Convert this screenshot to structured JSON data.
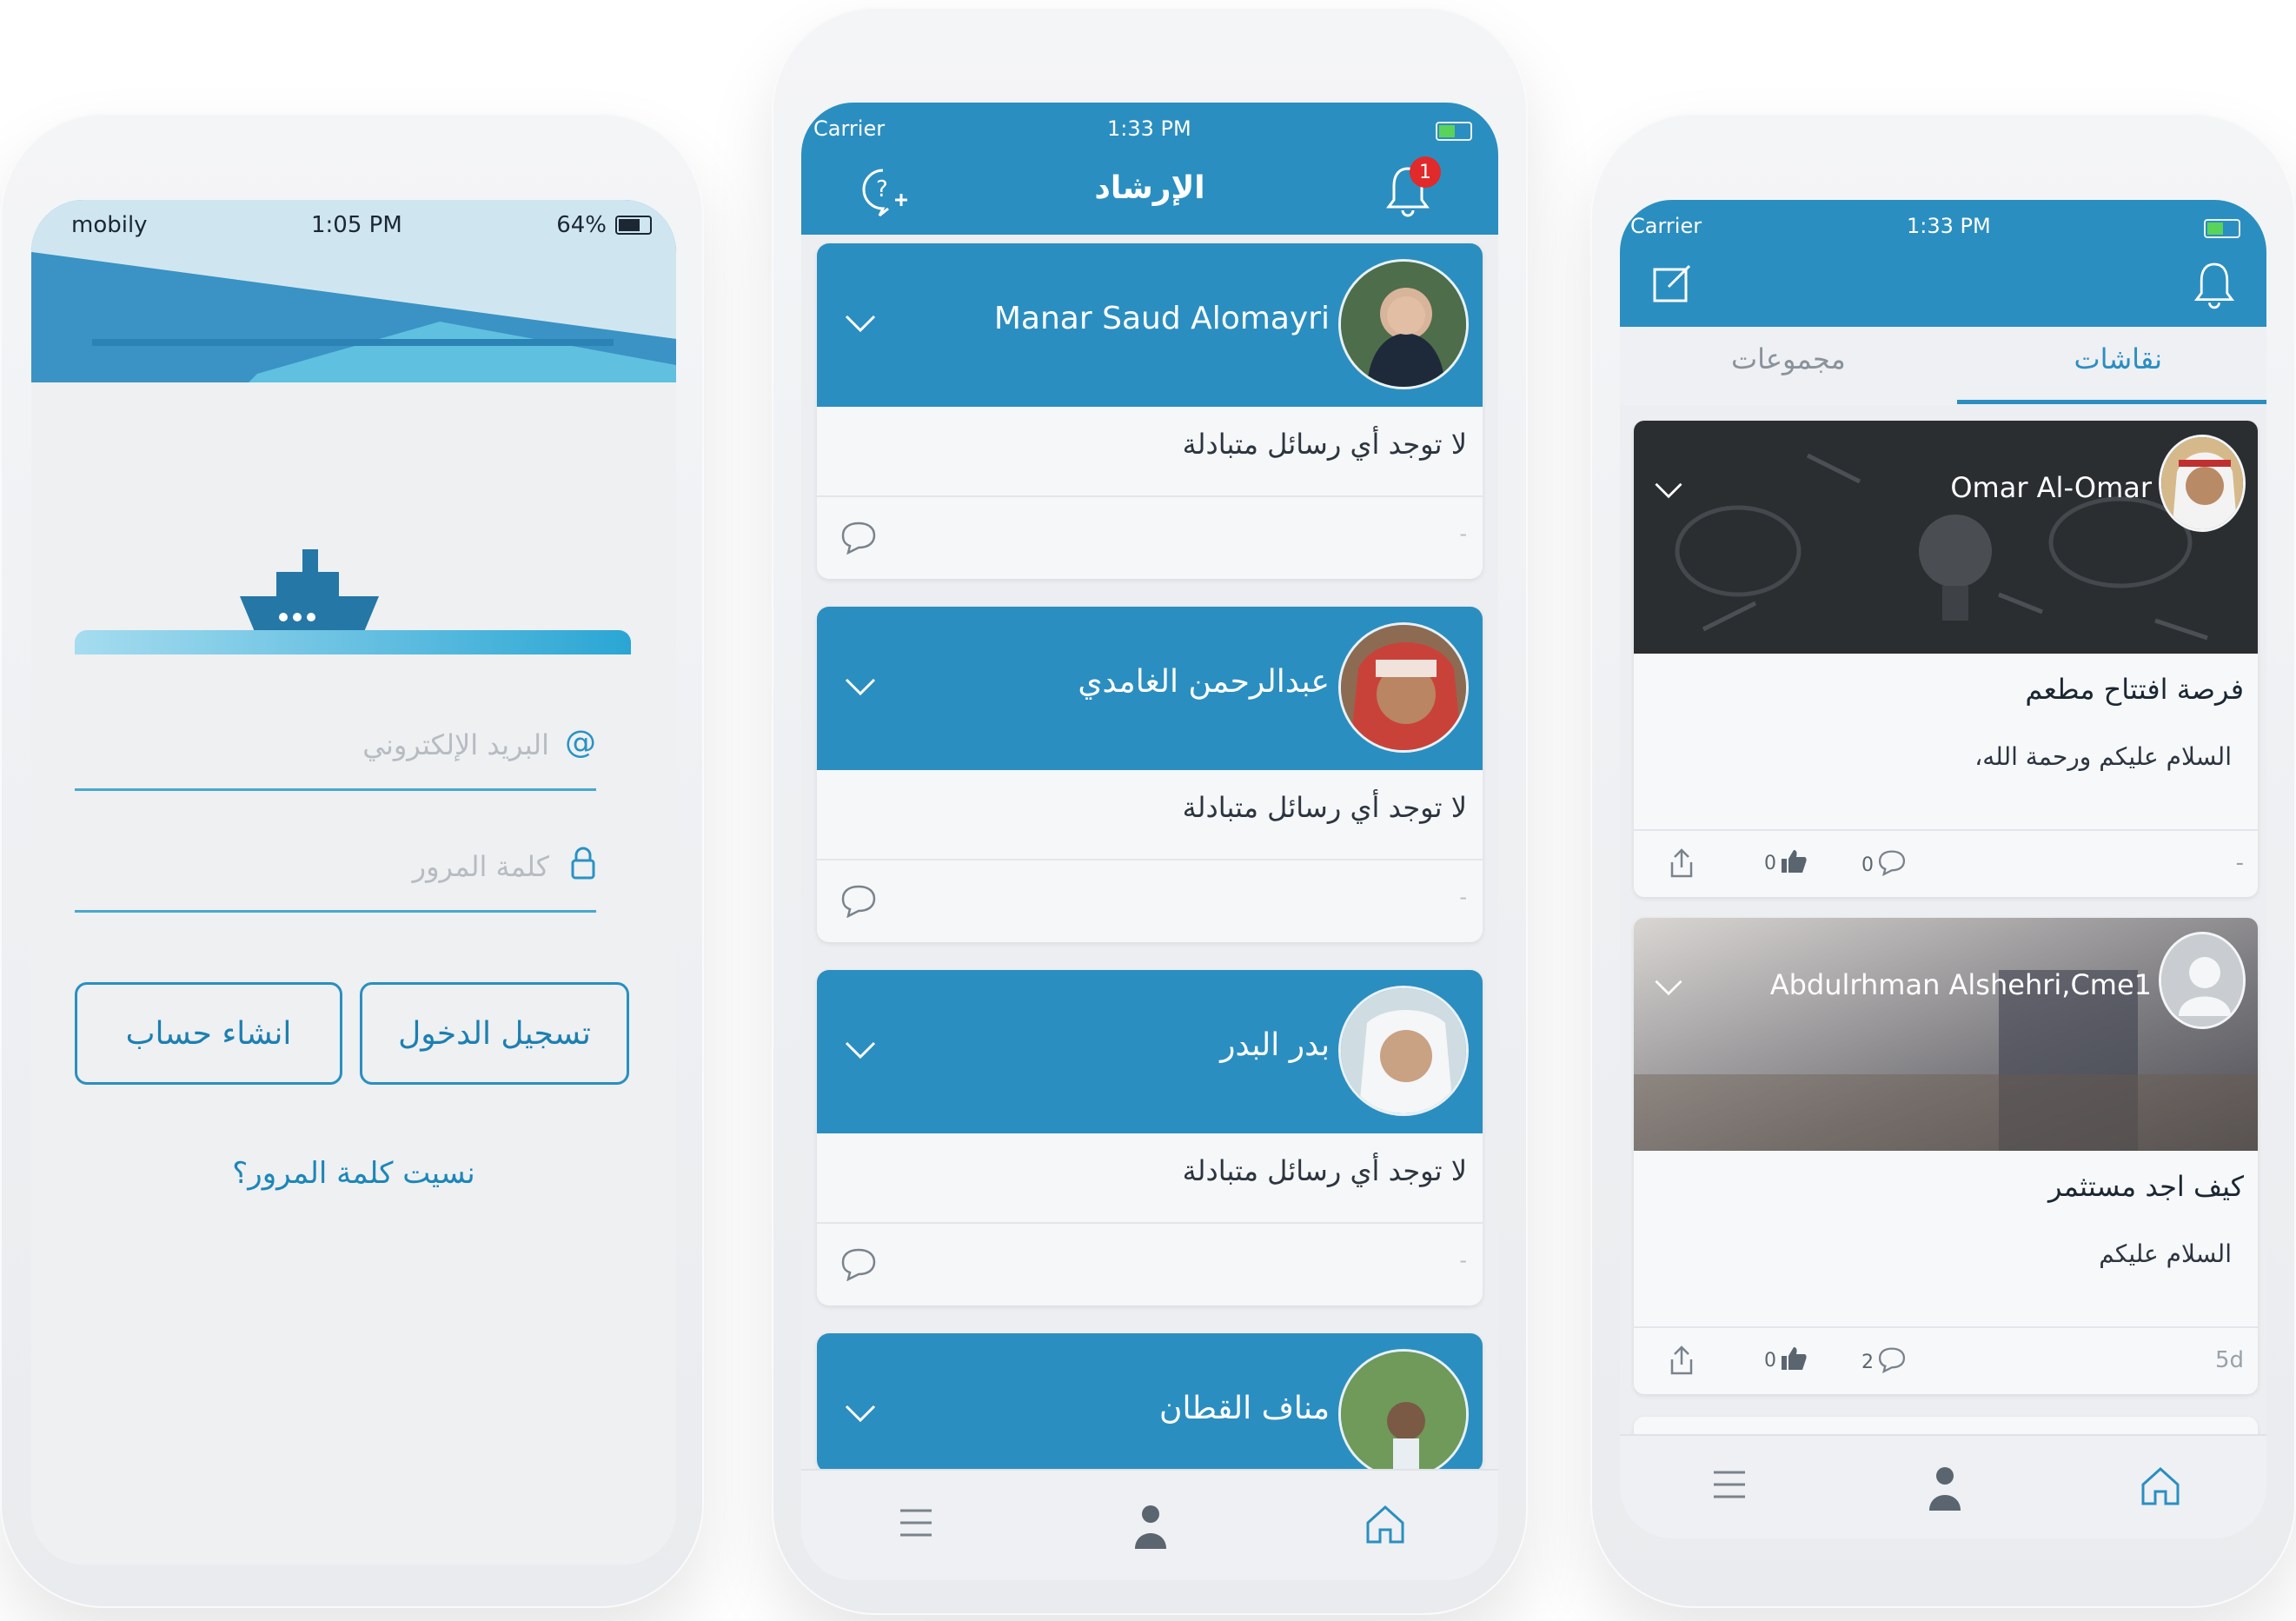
{
  "login_screen": {
    "status": {
      "carrier": "mobily",
      "time": "1:05 PM",
      "battery": "64%"
    },
    "email_placeholder": "البريد الإلكتروني",
    "password_placeholder": "كلمة المرور",
    "login_button": "تسجيل الدخول",
    "signup_button": "انشاء حساب",
    "forgot_link": "نسيت كلمة المرور؟",
    "icons": {
      "email": "at-icon",
      "password": "lock-icon",
      "logo": "ship-icon"
    }
  },
  "mentorship_screen": {
    "status": {
      "carrier": "Carrier",
      "time": "1:33 PM"
    },
    "title": "الإرشاد",
    "notification_count": "1",
    "cards": [
      {
        "name": "Manar Saud Alomayri",
        "message": "لا توجد أي رسائل متبادلة",
        "dash": "-"
      },
      {
        "name": "عبدالرحمن الغامدي",
        "message": "لا توجد أي رسائل متبادلة",
        "dash": "-"
      },
      {
        "name": "بدر البدر",
        "message": "لا توجد أي رسائل متبادلة",
        "dash": "-"
      },
      {
        "name": "مناف القطان"
      }
    ],
    "tabbar": [
      "menu-icon",
      "profile-icon",
      "home-icon"
    ]
  },
  "discussions_screen": {
    "status": {
      "carrier": "Carrier",
      "time": "1:33 PM"
    },
    "tabs": {
      "discussions": "نقاشات",
      "groups": "مجموعات"
    },
    "posts": [
      {
        "author": "Omar Al-Omar",
        "title": "فرصة افتتاح مطعم",
        "body": "السلام عليكم ورحمة الله،",
        "likes": "0",
        "comments": "0",
        "age": "-"
      },
      {
        "author": "Abdulrhman Alshehri,Cme1",
        "title": "كيف اجد مستثمر",
        "body": "السلام عليكم",
        "likes": "0",
        "comments": "2",
        "age": "5d"
      }
    ],
    "colors": {
      "primary": "#2b8ec0",
      "badge": "#e12a2a"
    }
  }
}
